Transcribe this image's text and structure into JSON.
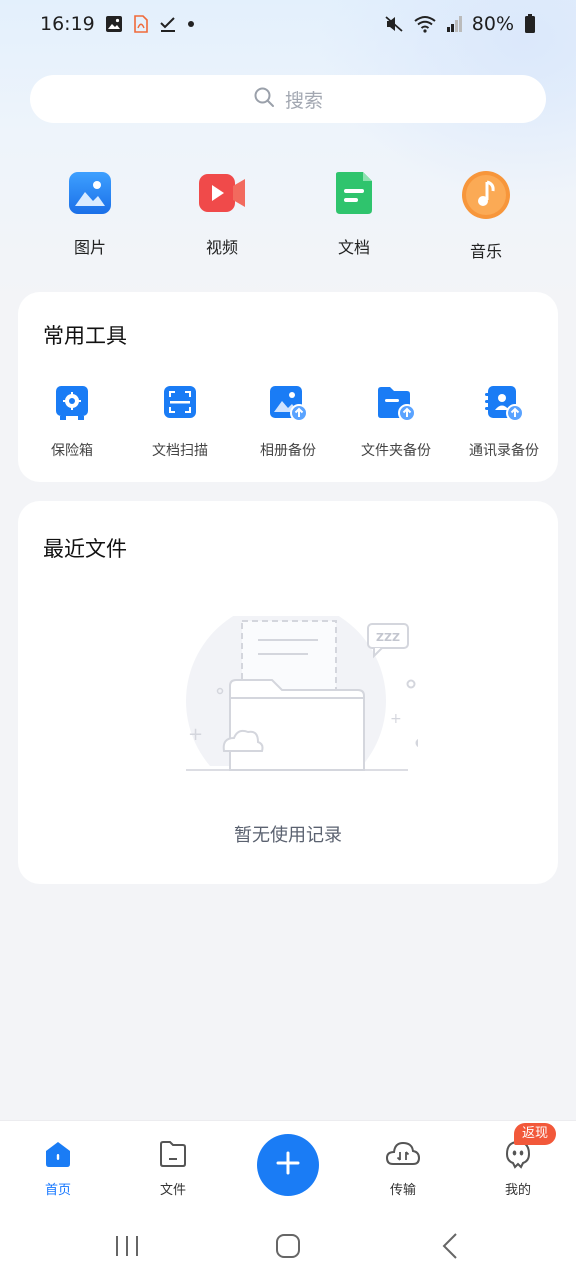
{
  "status_bar": {
    "time": "16:19",
    "battery": "80%"
  },
  "search": {
    "placeholder": "搜索"
  },
  "categories": [
    {
      "label": "图片",
      "icon": "image-icon",
      "color": "#2e86f5"
    },
    {
      "label": "视频",
      "icon": "video-icon",
      "color": "#f04a4a"
    },
    {
      "label": "文档",
      "icon": "document-icon",
      "color": "#2fc46d"
    },
    {
      "label": "音乐",
      "icon": "music-icon",
      "color": "#f7963b"
    }
  ],
  "tools": {
    "title": "常用工具",
    "items": [
      {
        "label": "保险箱",
        "icon": "safe-icon"
      },
      {
        "label": "文档扫描",
        "icon": "scan-icon"
      },
      {
        "label": "相册备份",
        "icon": "album-backup-icon"
      },
      {
        "label": "文件夹备份",
        "icon": "folder-backup-icon"
      },
      {
        "label": "通讯录备份",
        "icon": "contacts-backup-icon"
      }
    ],
    "accent": "#1a7cf5"
  },
  "recent": {
    "title": "最近文件",
    "empty_text": "暂无使用记录",
    "illustration_text": "ZZZ"
  },
  "bottom_nav": {
    "items": [
      {
        "label": "首页",
        "icon": "home-icon",
        "active": true
      },
      {
        "label": "文件",
        "icon": "file-icon",
        "active": false
      },
      {
        "label": "传输",
        "icon": "transfer-cloud-icon",
        "active": false
      },
      {
        "label": "我的",
        "icon": "profile-icon",
        "active": false
      }
    ],
    "badge": "返现",
    "fab_icon": "plus-icon"
  }
}
